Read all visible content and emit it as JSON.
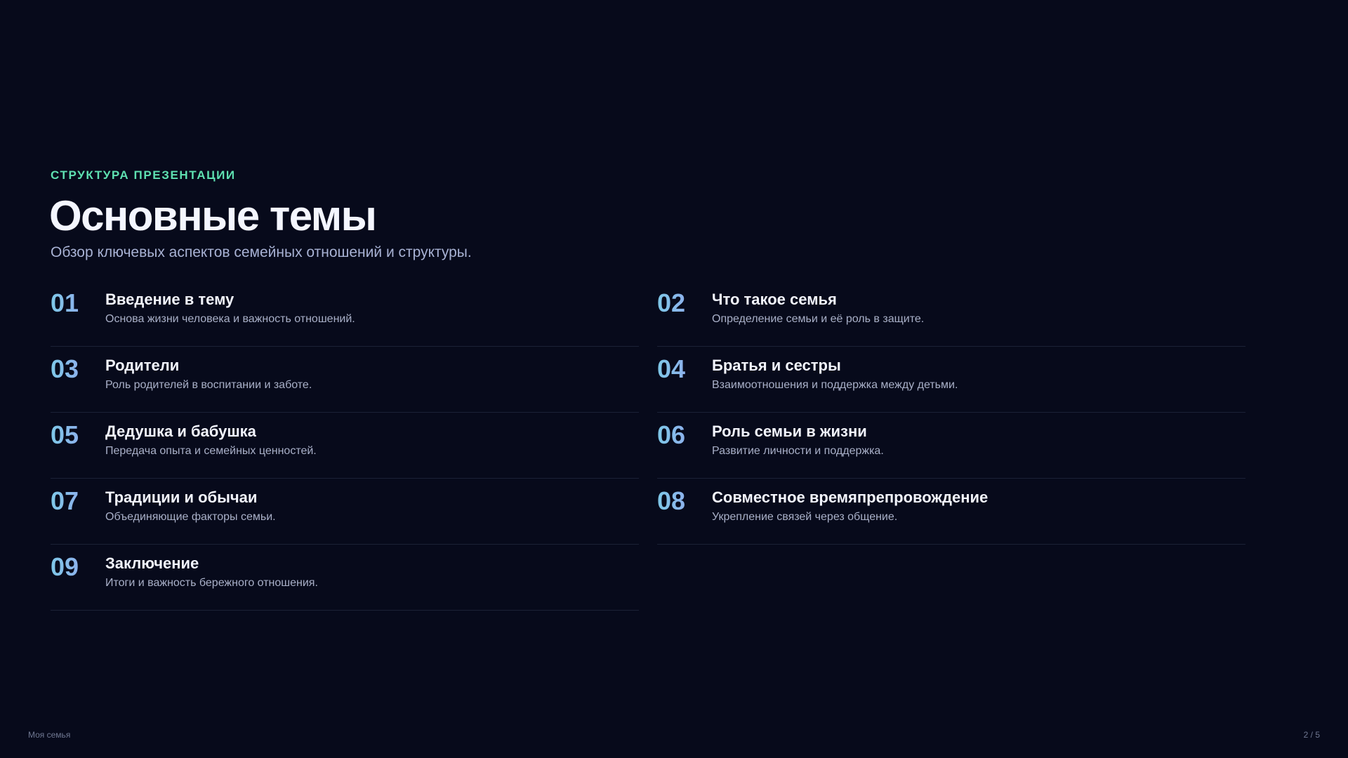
{
  "header": {
    "eyebrow": "СТРУКТУРА ПРЕЗЕНТАЦИИ",
    "title": "Основные темы",
    "subtitle": "Обзор ключевых аспектов семейных отношений и структуры."
  },
  "topics": [
    {
      "num": "01",
      "title": "Введение в тему",
      "desc": "Основа жизни человека и важность отношений."
    },
    {
      "num": "02",
      "title": "Что такое семья",
      "desc": "Определение семьи и её роль в защите."
    },
    {
      "num": "03",
      "title": "Родители",
      "desc": "Роль родителей в воспитании и заботе."
    },
    {
      "num": "04",
      "title": "Братья и сестры",
      "desc": "Взаимоотношения и поддержка между детьми."
    },
    {
      "num": "05",
      "title": "Дедушка и бабушка",
      "desc": "Передача опыта и семейных ценностей."
    },
    {
      "num": "06",
      "title": "Роль семьи в жизни",
      "desc": "Развитие личности и поддержка."
    },
    {
      "num": "07",
      "title": "Традиции и обычаи",
      "desc": "Объединяющие факторы семьи."
    },
    {
      "num": "08",
      "title": "Совместное времяпрепровождение",
      "desc": "Укрепление связей через общение."
    },
    {
      "num": "09",
      "title": "Заключение",
      "desc": "Итоги и важность бережного отношения."
    }
  ],
  "footer": {
    "deck_name": "Моя семья",
    "page_indicator": "2 / 5"
  },
  "colors": {
    "background": "#070a1b",
    "accent": "#5ee0b1",
    "number_gradient_start": "#7ec8e8",
    "number_gradient_end": "#9a9df0"
  }
}
